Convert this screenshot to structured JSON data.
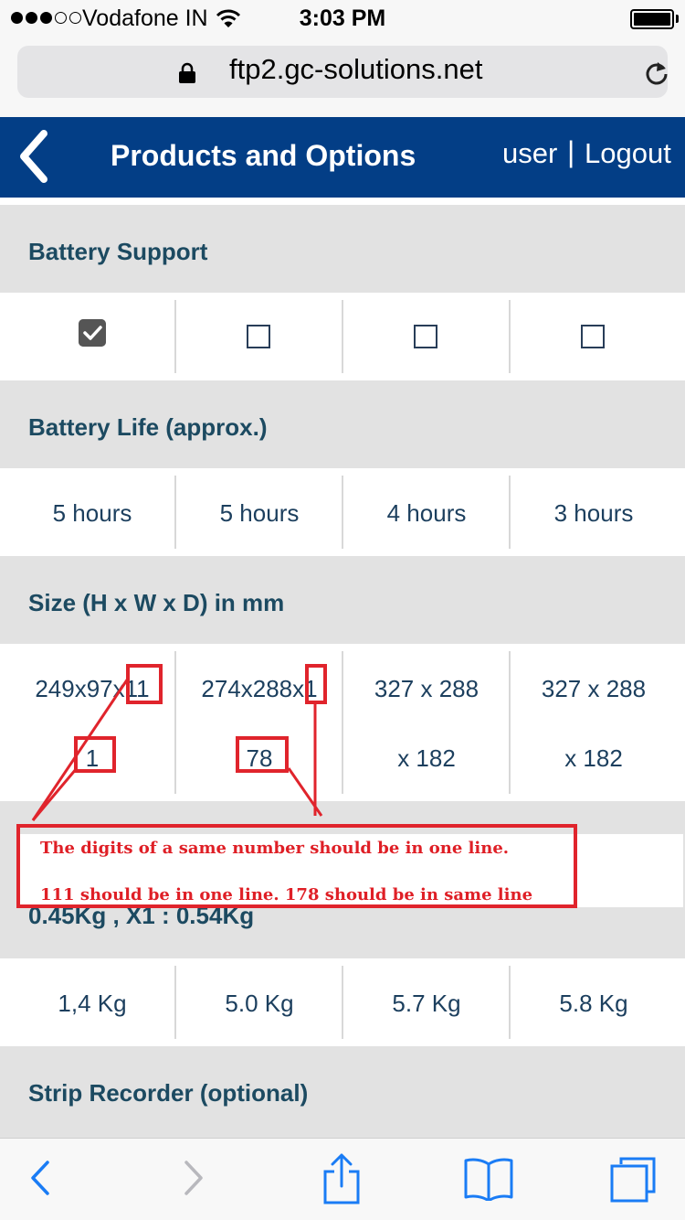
{
  "status_bar": {
    "carrier": "Vodafone IN",
    "time": "3:03 PM"
  },
  "browser": {
    "url": "ftp2.gc-solutions.net"
  },
  "header": {
    "title": "Products and Options",
    "user_label": "user",
    "separator": "|",
    "logout_label": "Logout"
  },
  "sections": {
    "battery_support": {
      "title": "Battery Support",
      "checked": [
        true,
        false,
        false,
        false
      ]
    },
    "battery_life": {
      "title": "Battery Life (approx.)",
      "values": [
        "5 hours",
        "5 hours",
        "4 hours",
        "3 hours"
      ]
    },
    "size": {
      "title": "Size (H x W x D) in mm",
      "line1": [
        "249x97x11",
        "274x288x1",
        "327 x 288",
        "327 x 288"
      ],
      "line2": [
        "1",
        "78",
        "x 182",
        "x 182"
      ]
    },
    "weight": {
      "title_fragment": "0.45Kg , X1 : 0.54Kg",
      "values": [
        "1,4 Kg",
        "5.0 Kg",
        "5.7 Kg",
        "5.8 Kg"
      ]
    },
    "strip_recorder": {
      "title": "Strip Recorder (optional)"
    }
  },
  "annotation": {
    "line1": "The digits of a same number should be in one line.",
    "line2": "111 should be in one line. 178 should be in same line",
    "color": "#e0242c"
  },
  "colors": {
    "header_bg": "#033e86",
    "section_bg": "#e2e2e2",
    "text": "#1c3f5e",
    "ios_blue": "#1a7cf5"
  }
}
